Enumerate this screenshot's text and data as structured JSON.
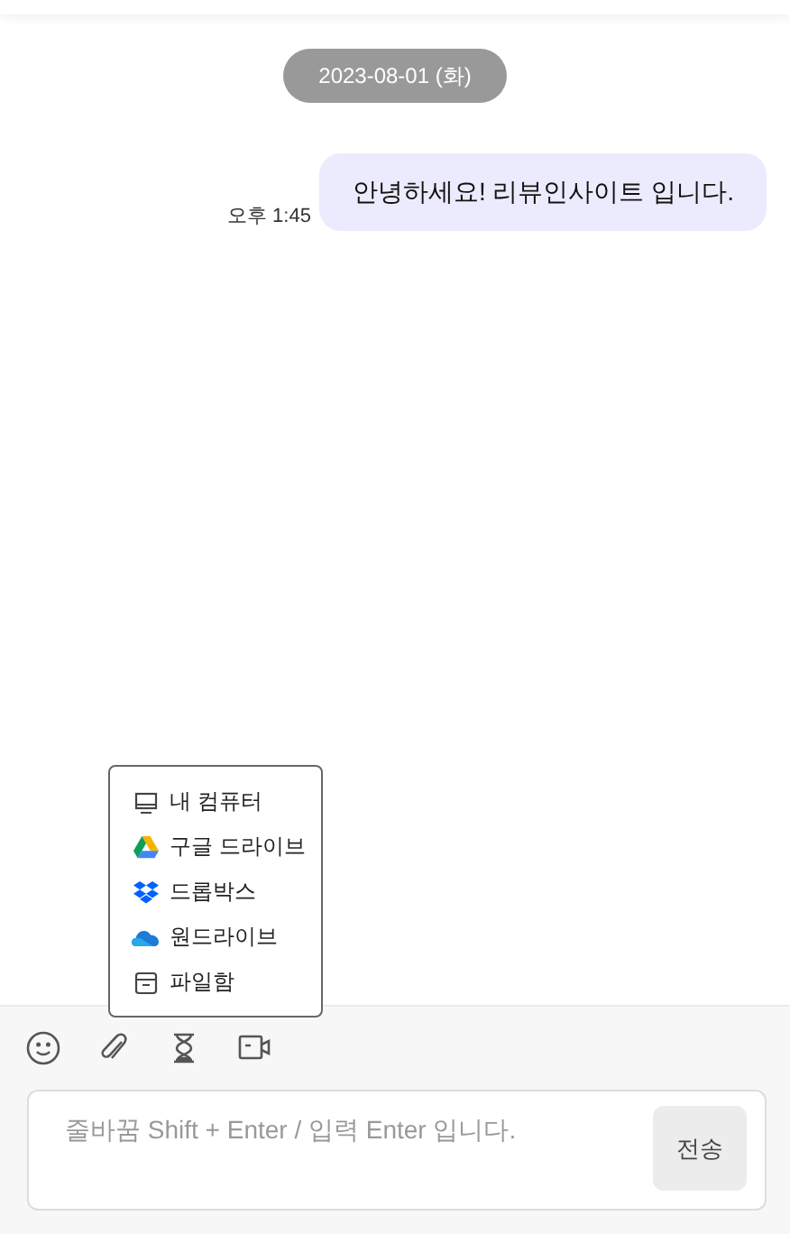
{
  "date_divider": "2023-08-01 (화)",
  "messages": [
    {
      "text": "안녕하세요! 리뷰인사이트 입니다.",
      "time": "오후 1:45"
    }
  ],
  "attach_menu": [
    {
      "kind": "computer",
      "label": "내 컴퓨터"
    },
    {
      "kind": "gdrive",
      "label": "구글 드라이브"
    },
    {
      "kind": "dropbox",
      "label": "드롭박스"
    },
    {
      "kind": "onedrive",
      "label": "원드라이브"
    },
    {
      "kind": "box",
      "label": "파일함"
    }
  ],
  "composer": {
    "placeholder": "줄바꿈 Shift + Enter / 입력 Enter 입니다.",
    "send": "전송"
  }
}
